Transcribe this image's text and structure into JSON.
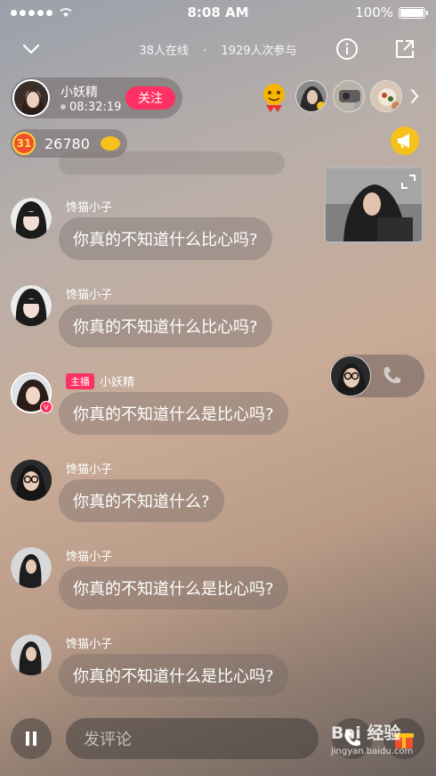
{
  "status_bar": {
    "time": "8:08 AM",
    "battery": "100%",
    "signal_icon": "signal-dots-icon",
    "wifi_icon": "wifi-icon"
  },
  "top_nav": {
    "online_count": "38人在线",
    "separator": "·",
    "participants": "1929人次参与"
  },
  "host": {
    "name": "小妖精",
    "timer": "08:32:19",
    "follow_label": "关注"
  },
  "coins": {
    "level": "31",
    "count": "26780"
  },
  "messages": [
    {
      "name": "馋猫小子",
      "text": "你真的不知道什么比心吗?",
      "is_host": false
    },
    {
      "name": "馋猫小子",
      "text": "你真的不知道什么比心吗?",
      "is_host": false
    },
    {
      "name": "小妖精",
      "tag": "主播",
      "text": "你真的不知道什么是比心吗?",
      "is_host": true
    },
    {
      "name": "馋猫小子",
      "text": "你真的不知道什么?",
      "is_host": false
    },
    {
      "name": "馋猫小子",
      "text": "你真的不知道什么是比心吗?",
      "is_host": false
    },
    {
      "name": "馋猫小子",
      "text": "你真的不知道什么是比心吗?",
      "is_host": false
    }
  ],
  "bottom_bar": {
    "comment_placeholder": "发评论"
  },
  "watermark": {
    "brand": "Bai 经验",
    "url": "jingyan.baidu.com"
  },
  "colors": {
    "accent": "#fd3163",
    "gold": "#f6c11b"
  }
}
